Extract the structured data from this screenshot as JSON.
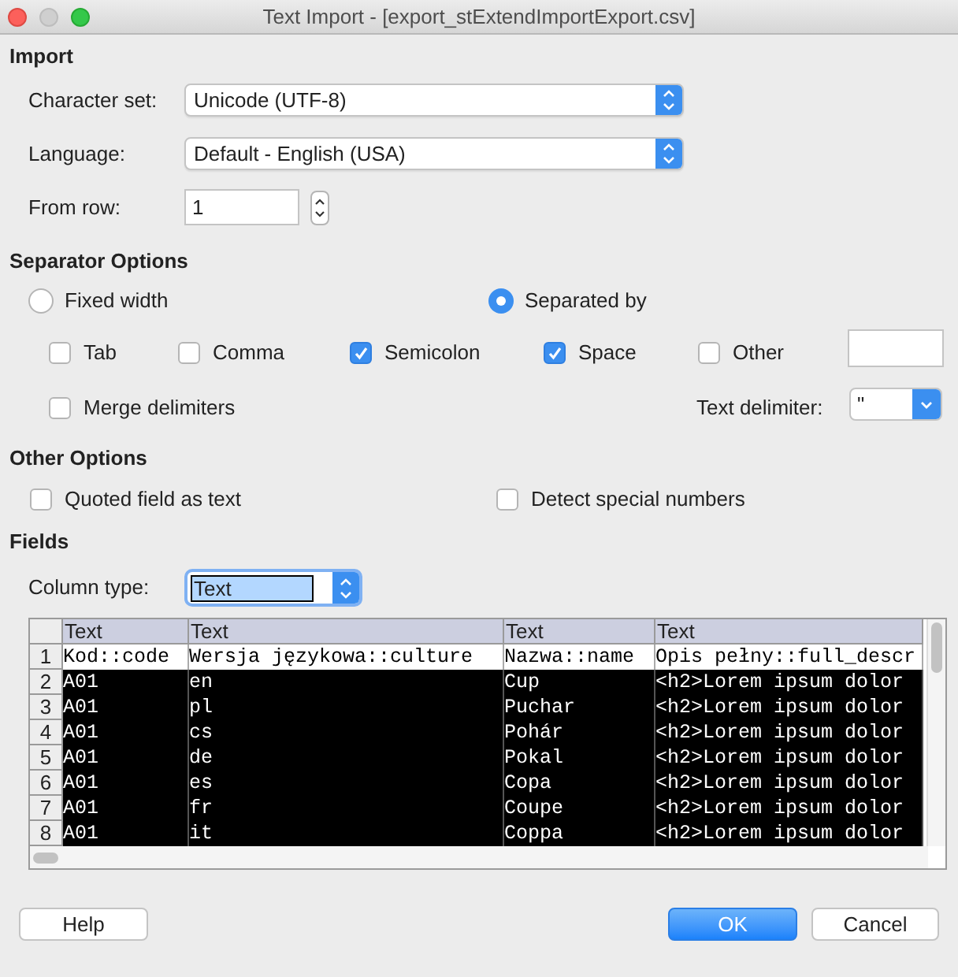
{
  "window": {
    "title": "Text Import - [export_stExtendImportExport.csv]"
  },
  "import": {
    "heading": "Import",
    "character_set": {
      "label": "Character set:",
      "value": "Unicode (UTF-8)"
    },
    "language": {
      "label": "Language:",
      "value": "Default - English (USA)"
    },
    "from_row": {
      "label": "From row:",
      "value": "1"
    }
  },
  "separator_options": {
    "heading": "Separator Options",
    "modes": [
      {
        "label": "Fixed width",
        "selected": false
      },
      {
        "label": "Separated by",
        "selected": true
      }
    ],
    "separators": [
      {
        "label": "Tab",
        "checked": false
      },
      {
        "label": "Comma",
        "checked": false
      },
      {
        "label": "Semicolon",
        "checked": true
      },
      {
        "label": "Space",
        "checked": true
      },
      {
        "label": "Other",
        "checked": false
      }
    ],
    "merge_delimiters": {
      "label": "Merge delimiters",
      "checked": false
    },
    "text_delimiter": {
      "label": "Text delimiter:",
      "value": "\""
    }
  },
  "other_options": {
    "heading": "Other Options",
    "options": [
      {
        "label": "Quoted field as text",
        "checked": false
      },
      {
        "label": "Detect special numbers",
        "checked": false
      }
    ]
  },
  "fields": {
    "heading": "Fields",
    "column_type": {
      "label": "Column type:",
      "value": "Text"
    },
    "table": {
      "columns": [
        "Text",
        "Text",
        "Text",
        "Text"
      ],
      "rows": [
        {
          "number": "1",
          "selected": false,
          "cells": [
            "Kod::code",
            "Wersja językowa::culture",
            "Nazwa::name",
            "Opis pełny::full_descr"
          ]
        },
        {
          "number": "2",
          "selected": true,
          "cells": [
            "A01",
            "en",
            "Cup",
            "<h2>Lorem ipsum dolor"
          ]
        },
        {
          "number": "3",
          "selected": true,
          "cells": [
            "A01",
            "pl",
            "Puchar",
            "<h2>Lorem ipsum dolor"
          ]
        },
        {
          "number": "4",
          "selected": true,
          "cells": [
            "A01",
            "cs",
            "Pohár",
            "<h2>Lorem ipsum dolor"
          ]
        },
        {
          "number": "5",
          "selected": true,
          "cells": [
            "A01",
            "de",
            "Pokal",
            "<h2>Lorem ipsum dolor"
          ]
        },
        {
          "number": "6",
          "selected": true,
          "cells": [
            "A01",
            "es",
            "Copa",
            "<h2>Lorem ipsum dolor"
          ]
        },
        {
          "number": "7",
          "selected": true,
          "cells": [
            "A01",
            "fr",
            "Coupe",
            "<h2>Lorem ipsum dolor"
          ]
        },
        {
          "number": "8",
          "selected": true,
          "cells": [
            "A01",
            "it",
            "Coppa",
            "<h2>Lorem ipsum dolor"
          ]
        }
      ]
    }
  },
  "buttons": [
    {
      "label": "Help",
      "kind": "default"
    },
    {
      "label": "OK",
      "kind": "primary"
    },
    {
      "label": "Cancel",
      "kind": "default"
    }
  ]
}
